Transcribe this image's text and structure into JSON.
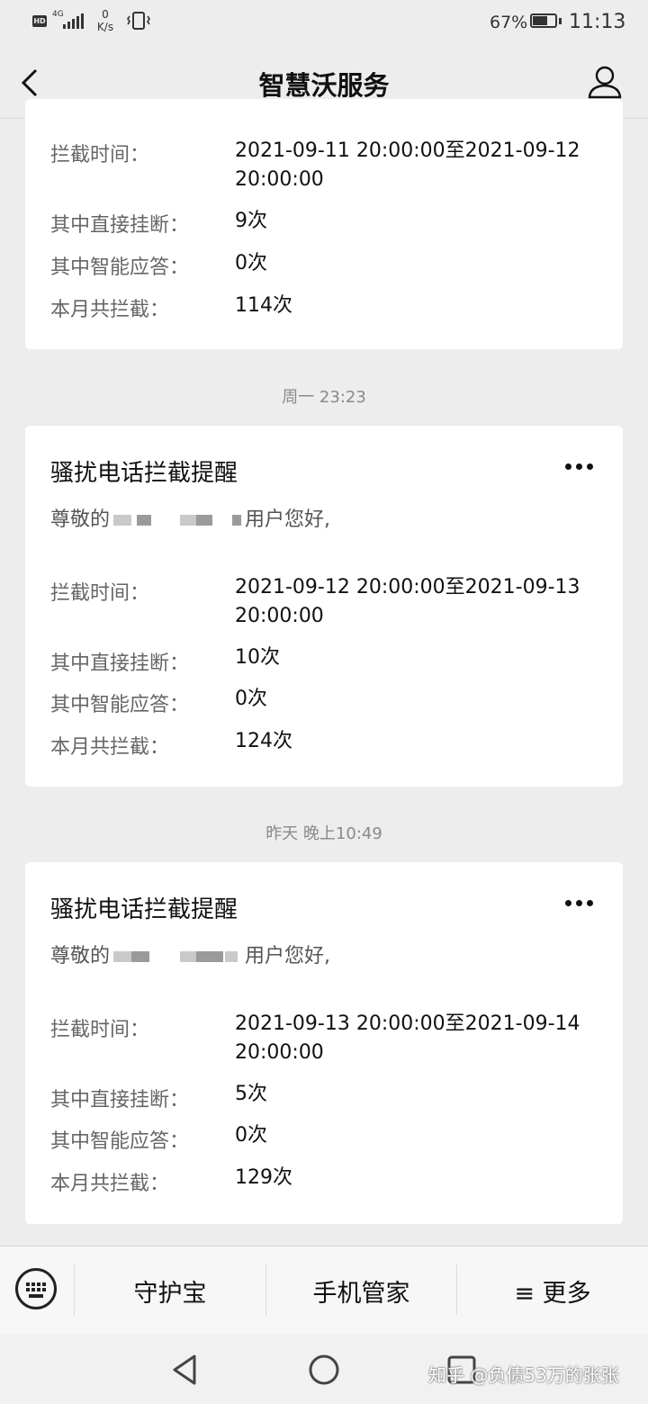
{
  "status_bar": {
    "network_badge": "HD",
    "network_type": "4G",
    "speed_value": "0",
    "speed_unit": "K/s",
    "battery_percent": "67%",
    "battery_level": 0.67,
    "time": "11:13",
    "icons": [
      "hd-icon",
      "signal-icon",
      "vibrate-icon",
      "battery-icon"
    ]
  },
  "header": {
    "title": "智慧沃服务",
    "back_icon": "chevron-left-icon",
    "profile_icon": "person-icon"
  },
  "messages": [
    {
      "timestamp": "",
      "title": "",
      "greeting_prefix": "",
      "greeting_suffix": "",
      "rows": [
        {
          "label": "拦截时间：",
          "value_line1": "2021-09-11 20:00:00至2021-09-12",
          "value_line2": "20:00:00"
        },
        {
          "label": "其中直接挂断：",
          "value_line1": "9次"
        },
        {
          "label": "其中智能应答：",
          "value_line1": "0次"
        },
        {
          "label": "本月共拦截：",
          "value_line1": "114次"
        }
      ]
    },
    {
      "timestamp": "周一 23:23",
      "title": "骚扰电话拦截提醒",
      "greeting_prefix": "尊敬的",
      "greeting_suffix": "用户您好,",
      "rows": [
        {
          "label": "拦截时间：",
          "value_line1": "2021-09-12 20:00:00至2021-09-13",
          "value_line2": "20:00:00"
        },
        {
          "label": "其中直接挂断：",
          "value_line1": "10次"
        },
        {
          "label": "其中智能应答：",
          "value_line1": "0次"
        },
        {
          "label": "本月共拦截：",
          "value_line1": "124次"
        }
      ]
    },
    {
      "timestamp": "昨天 晚上10:49",
      "title": "骚扰电话拦截提醒",
      "greeting_prefix": "尊敬的",
      "greeting_suffix": "用户您好,",
      "rows": [
        {
          "label": "拦截时间：",
          "value_line1": "2021-09-13 20:00:00至2021-09-14",
          "value_line2": "20:00:00"
        },
        {
          "label": "其中直接挂断：",
          "value_line1": "5次"
        },
        {
          "label": "其中智能应答：",
          "value_line1": "0次"
        },
        {
          "label": "本月共拦截：",
          "value_line1": "129次"
        }
      ]
    }
  ],
  "bottom_menu": {
    "keyboard_icon": "keyboard-icon",
    "items": [
      {
        "label": "守护宝"
      },
      {
        "label": "手机管家"
      },
      {
        "label": "≡ 更多"
      }
    ]
  },
  "nav_bar": {
    "icons": [
      "back-triangle-icon",
      "home-circle-icon",
      "recents-square-icon"
    ]
  },
  "watermark": "知乎 @负债53万的张张"
}
